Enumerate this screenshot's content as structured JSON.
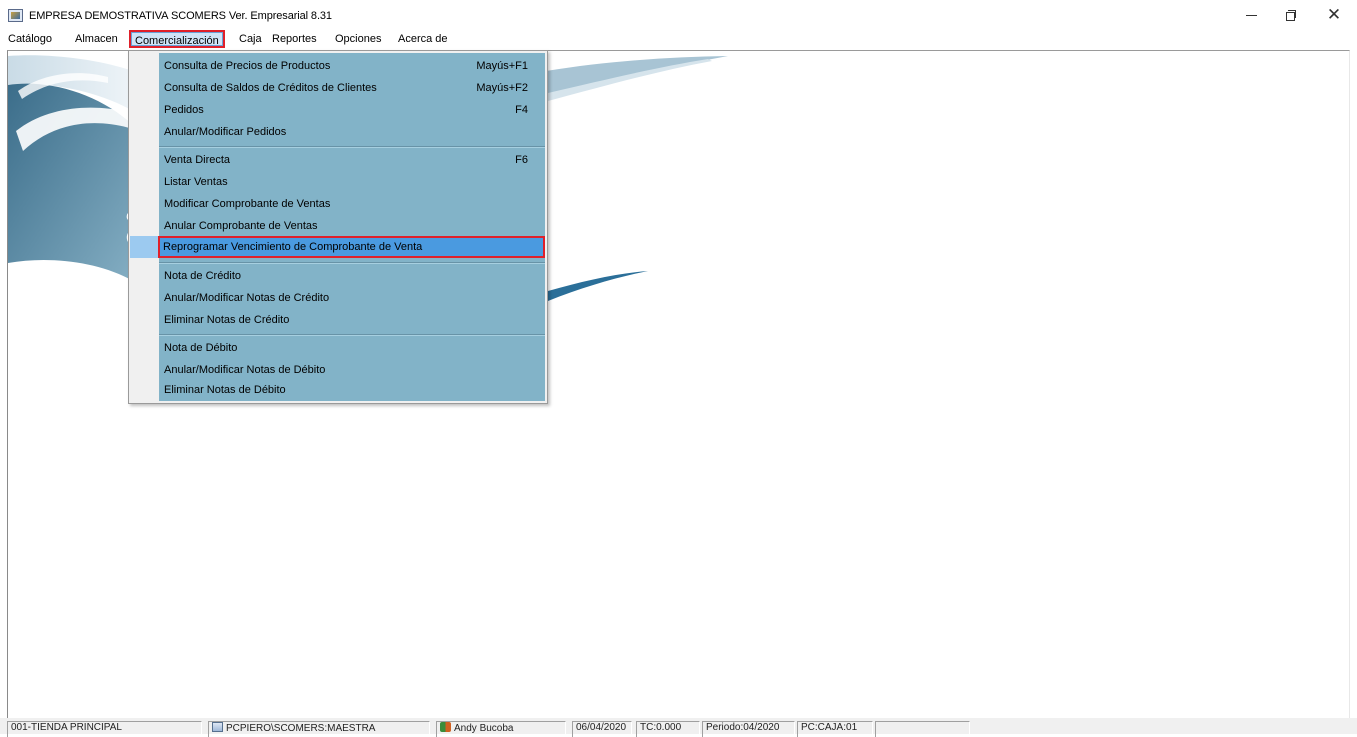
{
  "window": {
    "company": "EMPRESA DEMOSTRATIVA",
    "version": "SCOMERS Ver. Empresarial  8.31",
    "minimize_icon": "minimize-icon",
    "maximize_icon": "restore-icon",
    "close_icon": "close-icon",
    "close_glyph": "✕"
  },
  "menubar": {
    "items": [
      {
        "label": "Catálogo"
      },
      {
        "label": "Almacen"
      },
      {
        "label": "Comercialización"
      },
      {
        "label": "Caja"
      },
      {
        "label": "Reportes"
      },
      {
        "label": "Opciones"
      },
      {
        "label": "Acerca de"
      }
    ],
    "active_index": 2
  },
  "dropdown": {
    "groups": [
      [
        {
          "label": "Consulta de Precios de Productos",
          "shortcut": "Mayús+F1"
        },
        {
          "label": "Consulta de Saldos de Créditos de Clientes",
          "shortcut": "Mayús+F2"
        },
        {
          "label": "Pedidos",
          "shortcut": "F4"
        },
        {
          "label": "Anular/Modificar Pedidos",
          "shortcut": ""
        }
      ],
      [
        {
          "label": "Venta Directa",
          "shortcut": "F6"
        },
        {
          "label": "Listar Ventas",
          "shortcut": ""
        },
        {
          "label": "Modificar Comprobante de Ventas",
          "shortcut": ""
        },
        {
          "label": "Anular Comprobante de Ventas",
          "shortcut": ""
        },
        {
          "label": "Reprogramar Vencimiento de Comprobante de Venta",
          "shortcut": "",
          "highlighted": true
        }
      ],
      [
        {
          "label": "Nota de Crédito",
          "shortcut": ""
        },
        {
          "label": "Anular/Modificar Notas de Crédito",
          "shortcut": ""
        },
        {
          "label": "Eliminar Notas de Crédito",
          "shortcut": ""
        }
      ],
      [
        {
          "label": "Nota de Débito",
          "shortcut": ""
        },
        {
          "label": "Anular/Modificar Notas de Débito",
          "shortcut": ""
        },
        {
          "label": "Eliminar Notas de Débito",
          "shortcut": ""
        }
      ]
    ]
  },
  "background": {
    "partial_text_1": "C",
    "partial_text_2": "("
  },
  "colors": {
    "dropdown_bg": "#82b3c8",
    "highlight_bg": "#4a9ae0",
    "annotation_red": "#e0202a"
  },
  "statusbar": {
    "store": "001-TIENDA PRINCIPAL",
    "database": "PCPIERO\\SCOMERS:MAESTRA",
    "user": "Andy Bucoba",
    "date": "06/04/2020",
    "tc": "TC:0.000",
    "period": "Periodo:04/2020",
    "pc": "PC:CAJA:01",
    "empty": ""
  }
}
